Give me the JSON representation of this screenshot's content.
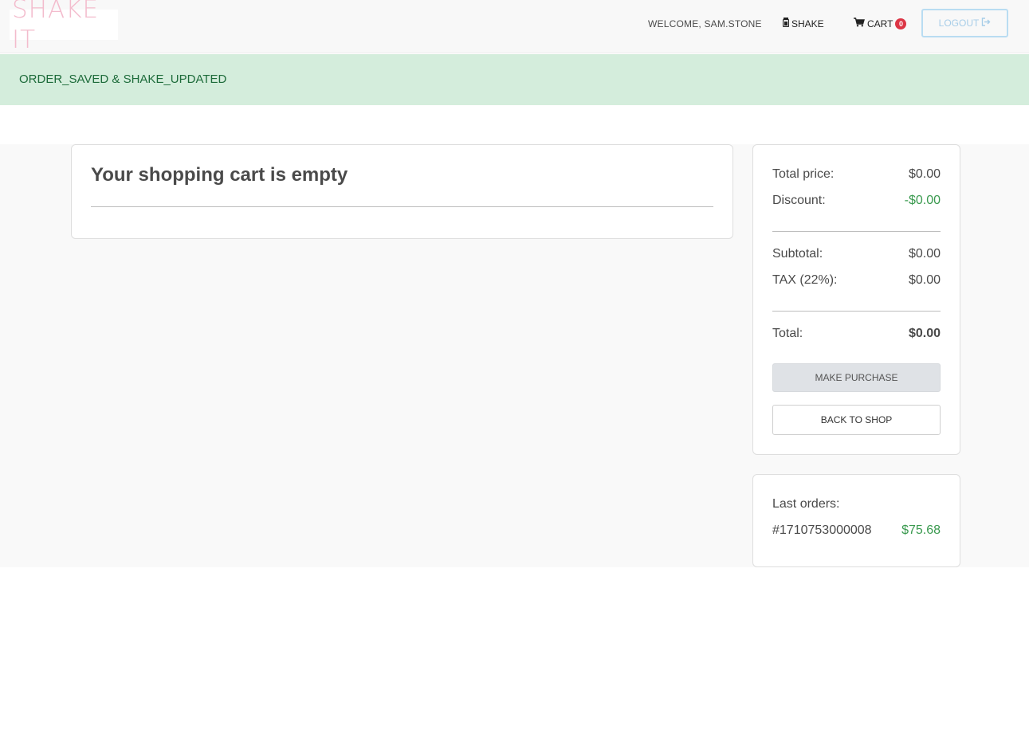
{
  "nav": {
    "logo_text": "SHAKE IT",
    "welcome": "WELCOME, SAM.STONE",
    "shake_label": "SHAKE",
    "cart_label": "CART",
    "cart_count": "0",
    "logout_label": "LOGOUT"
  },
  "alert": {
    "message": "ORDER_SAVED & SHAKE_UPDATED"
  },
  "cart": {
    "empty_title": "Your shopping cart is empty"
  },
  "summary": {
    "total_price_label": "Total price:",
    "total_price_value": "$0.00",
    "discount_label": "Discount:",
    "discount_value": "-$0.00",
    "subtotal_label": "Subtotal:",
    "subtotal_value": "$0.00",
    "tax_label": "TAX (22%):",
    "tax_value": "$0.00",
    "total_label": "Total:",
    "total_value": "$0.00",
    "purchase_button": "MAKE PURCHASE",
    "back_button": "BACK TO SHOP"
  },
  "orders": {
    "title": "Last orders:",
    "items": [
      {
        "id": "#1710753000008",
        "amount": "$75.68"
      }
    ]
  },
  "colors": {
    "logo": "#f3bccd",
    "alert_bg": "#d4eddc",
    "alert_text": "#1d6b3a",
    "positive": "#3a9a4f",
    "badge": "#dc3545",
    "logout_border": "#b9dcf2"
  }
}
